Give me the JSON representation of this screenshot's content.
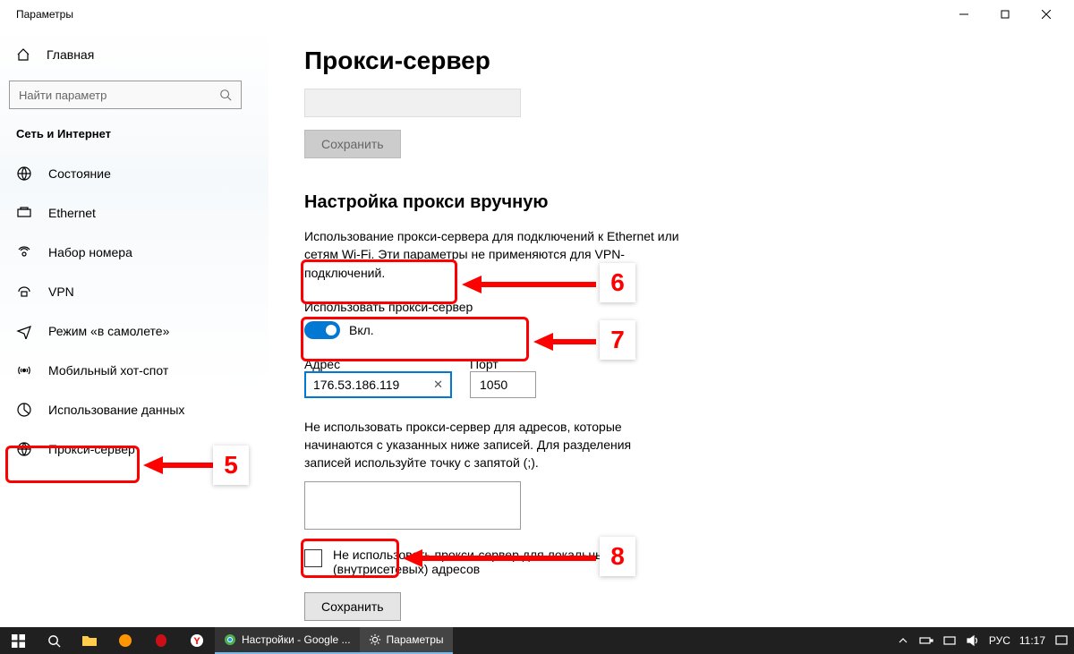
{
  "window": {
    "title": "Параметры"
  },
  "sidebar": {
    "home": "Главная",
    "search_placeholder": "Найти параметр",
    "section": "Сеть и Интернет",
    "items": [
      {
        "label": "Состояние"
      },
      {
        "label": "Ethernet"
      },
      {
        "label": "Набор номера"
      },
      {
        "label": "VPN"
      },
      {
        "label": "Режим «в самолете»"
      },
      {
        "label": "Мобильный хот-спот"
      },
      {
        "label": "Использование данных"
      },
      {
        "label": "Прокси-сервер"
      }
    ]
  },
  "content": {
    "h1": "Прокси-сервер",
    "save_disabled": "Сохранить",
    "h2": "Настройка прокси вручную",
    "desc": "Использование прокси-сервера для подключений к Ethernet или сетям Wi-Fi. Эти параметры не применяются для VPN-подключений.",
    "toggle_label": "Использовать прокси-сервер",
    "toggle_state": "Вкл.",
    "addr_label": "Адрес",
    "addr_value": "176.53.186.119",
    "port_label": "Порт",
    "port_value": "1050",
    "desc2": "Не использовать прокси-сервер для адресов, которые начинаются с указанных ниже записей. Для разделения записей используйте точку с запятой (;).",
    "checkbox_label": "Не использовать прокси-сервер для локальных (внутрисетевых) адресов",
    "save_enabled": "Сохранить"
  },
  "callouts": {
    "n5": "5",
    "n6": "6",
    "n7": "7",
    "n8": "8"
  },
  "taskbar": {
    "chrome": "Настройки - Google ...",
    "settings": "Параметры",
    "lang": "РУС",
    "time": "11:17"
  }
}
